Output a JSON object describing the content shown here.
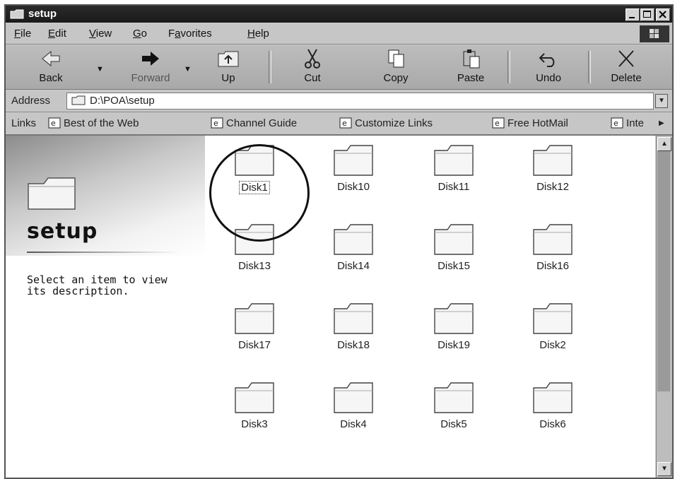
{
  "window": {
    "title": "setup"
  },
  "menu": {
    "items": [
      {
        "pre": "",
        "u": "F",
        "post": "ile"
      },
      {
        "pre": "",
        "u": "E",
        "post": "dit"
      },
      {
        "pre": "",
        "u": "V",
        "post": "iew"
      },
      {
        "pre": "",
        "u": "G",
        "post": "o"
      },
      {
        "pre": "F",
        "u": "a",
        "post": "vorites"
      },
      {
        "pre": "",
        "u": "H",
        "post": "elp"
      }
    ]
  },
  "toolbar": {
    "back": "Back",
    "forward": "Forward",
    "up": "Up",
    "cut": "Cut",
    "copy": "Copy",
    "paste": "Paste",
    "undo": "Undo",
    "delete": "Delete"
  },
  "address": {
    "label": "Address",
    "value": "D:\\POA\\setup"
  },
  "links": {
    "label": "Links",
    "items": [
      "Best of the Web",
      "Channel Guide",
      "Customize Links",
      "Free HotMail",
      "Inte"
    ]
  },
  "pane": {
    "title": "setup",
    "description": "Select an item to view its description."
  },
  "folders": [
    "Disk1",
    "Disk10",
    "Disk11",
    "Disk12",
    "Disk13",
    "Disk14",
    "Disk15",
    "Disk16",
    "Disk17",
    "Disk18",
    "Disk19",
    "Disk2",
    "Disk3",
    "Disk4",
    "Disk5",
    "Disk6"
  ],
  "selected_folder": "Disk1"
}
